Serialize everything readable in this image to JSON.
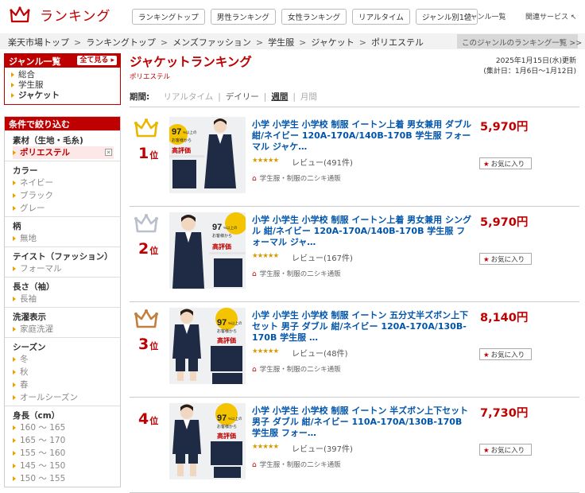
{
  "header": {
    "logo_text": "ランキング",
    "nav": [
      "ランキングトップ",
      "男性ランキング",
      "女性ランキング",
      "リアルタイム",
      "ジャンル別1位"
    ],
    "genre_list": "ジャンル一覧",
    "related": "関連サービス ↖"
  },
  "breadcrumb": [
    "楽天市場トップ",
    "ランキングトップ",
    "メンズファッション",
    "学生服",
    "ジャケット",
    "ポリエステル"
  ],
  "genre_ranking_link": "このジャンルのランキング一覧 >>",
  "sidebar": {
    "genre_title": "ジャンル一覧",
    "see_all": "全て見る",
    "genres": [
      "総合",
      "学生服",
      "ジャケット"
    ],
    "filter_title": "条件で絞り込む",
    "sections": [
      {
        "title": "素材（生地・毛糸)",
        "items": [
          "ポリエステル"
        ]
      },
      {
        "title": "カラー",
        "items": [
          "ネイビー",
          "ブラック",
          "グレー"
        ]
      },
      {
        "title": "柄",
        "items": [
          "無地"
        ]
      },
      {
        "title": "テイスト（ファッション）",
        "items": [
          "フォーマル"
        ]
      },
      {
        "title": "長さ（袖）",
        "items": [
          "長袖"
        ]
      },
      {
        "title": "洗濯表示",
        "items": [
          "家庭洗濯"
        ]
      },
      {
        "title": "シーズン",
        "items": [
          "冬",
          "秋",
          "春",
          "オールシーズン"
        ]
      },
      {
        "title": "身長（cm）",
        "items": [
          "160 ～ 165",
          "165 ～ 170",
          "155 ～ 160",
          "145 ～ 150",
          "150 ～ 155"
        ]
      }
    ]
  },
  "main": {
    "title": "ジャケットランキング",
    "subtitle": "ポリエステル",
    "updated": "2025年1月15日(水)更新",
    "period_range": "(集計日：1月6日～1月12日)",
    "period_label": "期間:",
    "periods": [
      "リアルタイム",
      "デイリー",
      "週間",
      "月間"
    ],
    "rank_suffix": "位",
    "fav_label": "お気に入り",
    "thumb_badge_pct": "97",
    "thumb_badge_top": "%以上の",
    "thumb_badge_mid": "お客様から",
    "thumb_badge_bottom": "高評価",
    "items": [
      {
        "rank": "1",
        "name": "小学 小学生 小学校 制服 イートン上着 男女兼用 ダブル 紺/ネイビー 120A-170A/140B-170B 学生服 フォーマル ジャケ…",
        "price": "5,970円",
        "stars": "★★★★★",
        "reviews": "レビュー(491件)",
        "shop": "学生服・制服の二シキ通販"
      },
      {
        "rank": "2",
        "name": "小学 小学生 小学校 制服 イートン上着 男女兼用 シングル 紺/ネイビー 120A-170A/140B-170B 学生服 フォーマル ジャ…",
        "price": "5,970円",
        "stars": "★★★★★",
        "reviews": "レビュー(167件)",
        "shop": "学生服・制服の二シキ通販"
      },
      {
        "rank": "3",
        "name": "小学 小学生 小学校 制服 イートン 五分丈半ズボン上下セット 男子 ダブル 紺/ネイビー 120A-170A/130B-170B 学生服 …",
        "price": "8,140円",
        "stars": "★★★★★",
        "reviews": "レビュー(48件)",
        "shop": "学生服・制服の二シキ通販"
      },
      {
        "rank": "4",
        "name": "小学 小学生 小学校 制服 イートン 半ズボン上下セット 男子 ダブル 紺/ネイビー 110A-170A/130B-170B 学生服 フォー…",
        "price": "7,730円",
        "stars": "★★★★★",
        "reviews": "レビュー(397件)",
        "shop": "学生服・制服の二シキ通販"
      }
    ]
  },
  "colors": {
    "accent": "#bf0000",
    "link": "#0055aa",
    "gold": "#e8b800",
    "silver": "#b8c0cc",
    "bronze": "#c08040",
    "navy": "#1f2a44"
  }
}
